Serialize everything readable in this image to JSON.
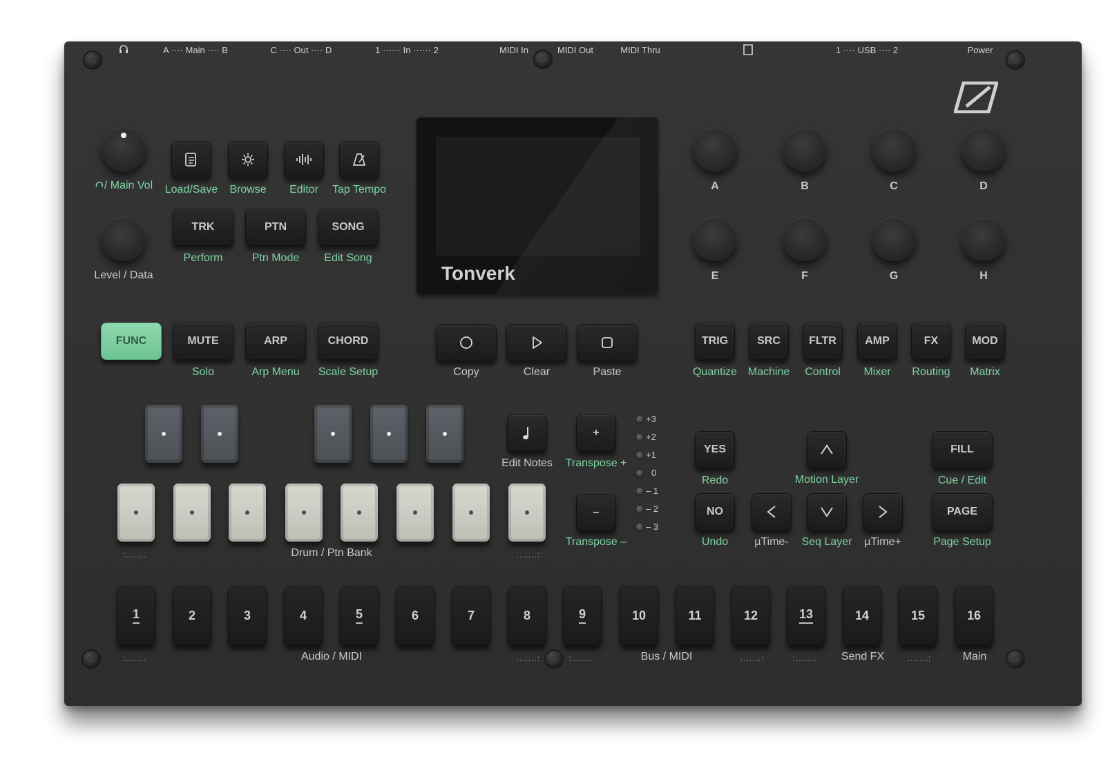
{
  "top_labels": {
    "headphones_icon": "headphones-icon",
    "main": "A ···· Main ···· B",
    "out": "C ···· Out ···· D",
    "in": "1 ······ In ······ 2",
    "midi_in": "MIDI In",
    "midi_out": "MIDI Out",
    "midi_thru": "MIDI Thru",
    "sd_icon": "sd-card-icon",
    "usb": "1 ···· USB ···· 2",
    "power": "Power"
  },
  "left_section": {
    "main_vol": "/ Main Vol",
    "level_data": "Level / Data",
    "icon_buttons": [
      {
        "icon": "document-icon",
        "label": "Load/Save"
      },
      {
        "icon": "gear-icon",
        "label": "Browse"
      },
      {
        "icon": "waveform-icon",
        "label": "Editor"
      },
      {
        "icon": "metronome-icon",
        "label": "Tap Tempo"
      }
    ],
    "mode_buttons": [
      {
        "label": "TRK",
        "sub": "Perform"
      },
      {
        "label": "PTN",
        "sub": "Ptn Mode"
      },
      {
        "label": "SONG",
        "sub": "Edit Song"
      }
    ],
    "func_row": [
      {
        "label": "FUNC",
        "sub": ""
      },
      {
        "label": "MUTE",
        "sub": "Solo"
      },
      {
        "label": "ARP",
        "sub": "Arp Menu"
      },
      {
        "label": "CHORD",
        "sub": "Scale Setup"
      }
    ]
  },
  "screen": {
    "brand": "Tonverk"
  },
  "transport": [
    {
      "icon": "record-icon",
      "label": "Copy"
    },
    {
      "icon": "play-icon",
      "label": "Clear"
    },
    {
      "icon": "stop-icon",
      "label": "Paste"
    }
  ],
  "knobs": [
    "A",
    "B",
    "C",
    "D",
    "E",
    "F",
    "G",
    "H"
  ],
  "page_buttons": [
    {
      "label": "TRIG",
      "sub": "Quantize"
    },
    {
      "label": "SRC",
      "sub": "Machine"
    },
    {
      "label": "FLTR",
      "sub": "Control"
    },
    {
      "label": "AMP",
      "sub": "Mixer"
    },
    {
      "label": "FX",
      "sub": "Routing"
    },
    {
      "label": "MOD",
      "sub": "Matrix"
    }
  ],
  "keyboard": {
    "bank_label": "Drum / Ptn Bank",
    "dots_left": ":.......",
    "dots_right": ".......:"
  },
  "edit_notes": {
    "icon": "note-icon",
    "label": "Edit Notes"
  },
  "transpose": {
    "plus_symbol": "+",
    "plus_label": "Transpose +",
    "minus_symbol": "–",
    "minus_label": "Transpose –",
    "levels": [
      "+3",
      "+2",
      "+1",
      "0",
      "– 1",
      "– 2",
      "– 3"
    ]
  },
  "nav": {
    "yes": "YES",
    "redo": "Redo",
    "no": "NO",
    "undo": "Undo",
    "motion_layer": "Motion Layer",
    "utime_minus": "µTime-",
    "seq_layer": "Seq Layer",
    "utime_plus": "µTime+",
    "fill": "FILL",
    "cue_edit": "Cue / Edit",
    "page": "PAGE",
    "page_setup": "Page Setup"
  },
  "steps": [
    "1",
    "2",
    "3",
    "4",
    "5",
    "6",
    "7",
    "8",
    "9",
    "10",
    "11",
    "12",
    "13",
    "14",
    "15",
    "16"
  ],
  "step_groups": {
    "audio_midi": "Audio / MIDI",
    "bus_midi": "Bus / MIDI",
    "send_fx": "Send FX",
    "main": "Main",
    "dots_left": ":.......",
    "dots_right": ".......:"
  },
  "colors": {
    "accent_green": "#7ed3a3",
    "func_green": "#7fd0a0",
    "body": "#2f2f2f"
  }
}
